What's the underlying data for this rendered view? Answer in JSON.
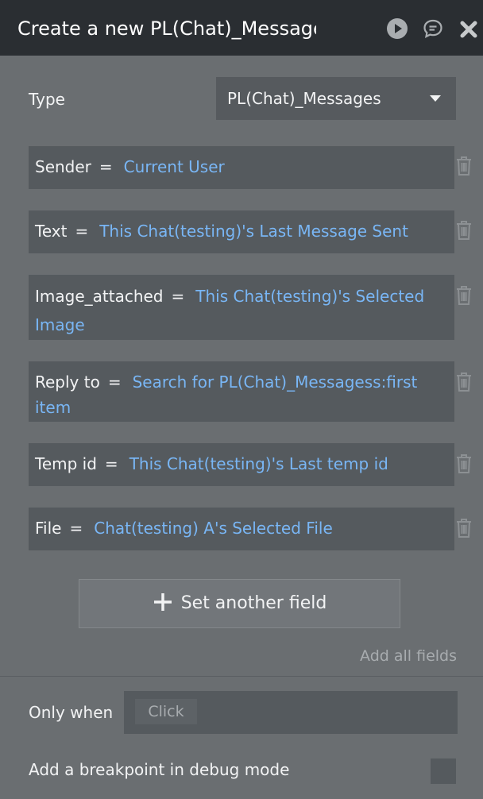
{
  "header": {
    "title": "Create a new PL(Chat)_Messages",
    "icons": [
      "play-icon",
      "comment-icon",
      "close-icon"
    ]
  },
  "type_row": {
    "label": "Type",
    "selected": "PL(Chat)_Messages"
  },
  "fields": [
    {
      "name": "Sender",
      "value": "Current User"
    },
    {
      "name": "Text",
      "value": "This Chat(testing)'s Last Message Sent"
    },
    {
      "name": "Image_attached",
      "value": "This Chat(testing)'s Selected Image"
    },
    {
      "name": "Reply to",
      "value": "Search for PL(Chat)_Messagess:first item"
    },
    {
      "name": "Temp id",
      "value": "This Chat(testing)'s Last temp id"
    },
    {
      "name": "File",
      "value": "Chat(testing) A's Selected File"
    }
  ],
  "equals_sign": "=",
  "set_another_label": "Set another field",
  "add_all_label": "Add all fields",
  "only_when": {
    "label": "Only when",
    "placeholder": "Click"
  },
  "breakpoint_label": "Add a breakpoint in debug mode",
  "colors": {
    "header_bg": "#2a2e32",
    "panel_bg": "#6a6e71",
    "field_bg": "#555a5e",
    "value_blue": "#79b6f5"
  }
}
